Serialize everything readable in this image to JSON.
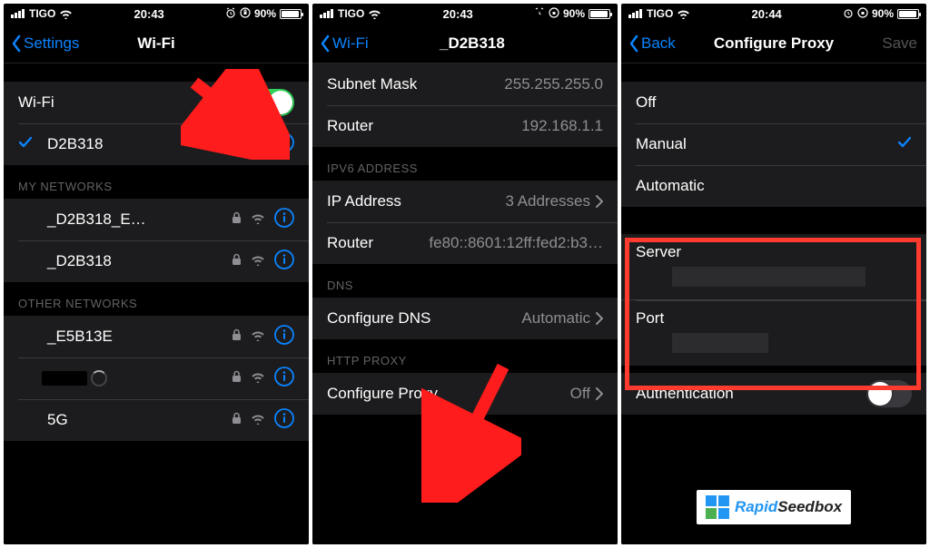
{
  "status": {
    "carrier": "TIGO",
    "time_a": "20:43",
    "time_b": "20:43",
    "time_c": "20:44",
    "battery_pct": "90%",
    "alarm_icon": "alarm-icon",
    "orientation_icon": "orientation-lock-icon"
  },
  "screen1": {
    "back_label": "Settings",
    "title": "Wi-Fi",
    "wifi_row_label": "Wi-Fi",
    "wifi_toggle": true,
    "connected_network": "D2B318",
    "section_my_networks": "MY NETWORKS",
    "my_networks": [
      {
        "name": "_D2B318_E…"
      },
      {
        "name": "_D2B318"
      }
    ],
    "section_other_networks": "OTHER NETWORKS",
    "other_networks": [
      {
        "name": "_E5B13E"
      },
      {
        "spinner": true
      },
      {
        "suffix": "5G"
      }
    ]
  },
  "screen2": {
    "back_label": "Wi-Fi",
    "title_suffix": "_D2B318",
    "rows": {
      "subnet_mask_label": "Subnet Mask",
      "subnet_mask_value": "255.255.255.0",
      "router_label": "Router",
      "router_value": "192.168.1.1"
    },
    "ipv6_header": "IPV6 ADDRESS",
    "ipv6": {
      "ip_label": "IP Address",
      "ip_value": "3 Addresses",
      "router_label": "Router",
      "router_value": "fe80::8601:12ff:fed2:b3…"
    },
    "dns_header": "DNS",
    "dns": {
      "configure_label": "Configure DNS",
      "configure_value": "Automatic"
    },
    "proxy_header": "HTTP PROXY",
    "proxy": {
      "configure_label": "Configure Proxy",
      "configure_value": "Off"
    }
  },
  "screen3": {
    "back_label": "Back",
    "title": "Configure Proxy",
    "save_label": "Save",
    "options": {
      "off": "Off",
      "manual": "Manual",
      "automatic": "Automatic"
    },
    "server_label": "Server",
    "port_label": "Port",
    "auth_label": "Authentication",
    "auth_toggle": false
  },
  "brand": {
    "part1": "Rapid",
    "part2": "Seedbox"
  }
}
